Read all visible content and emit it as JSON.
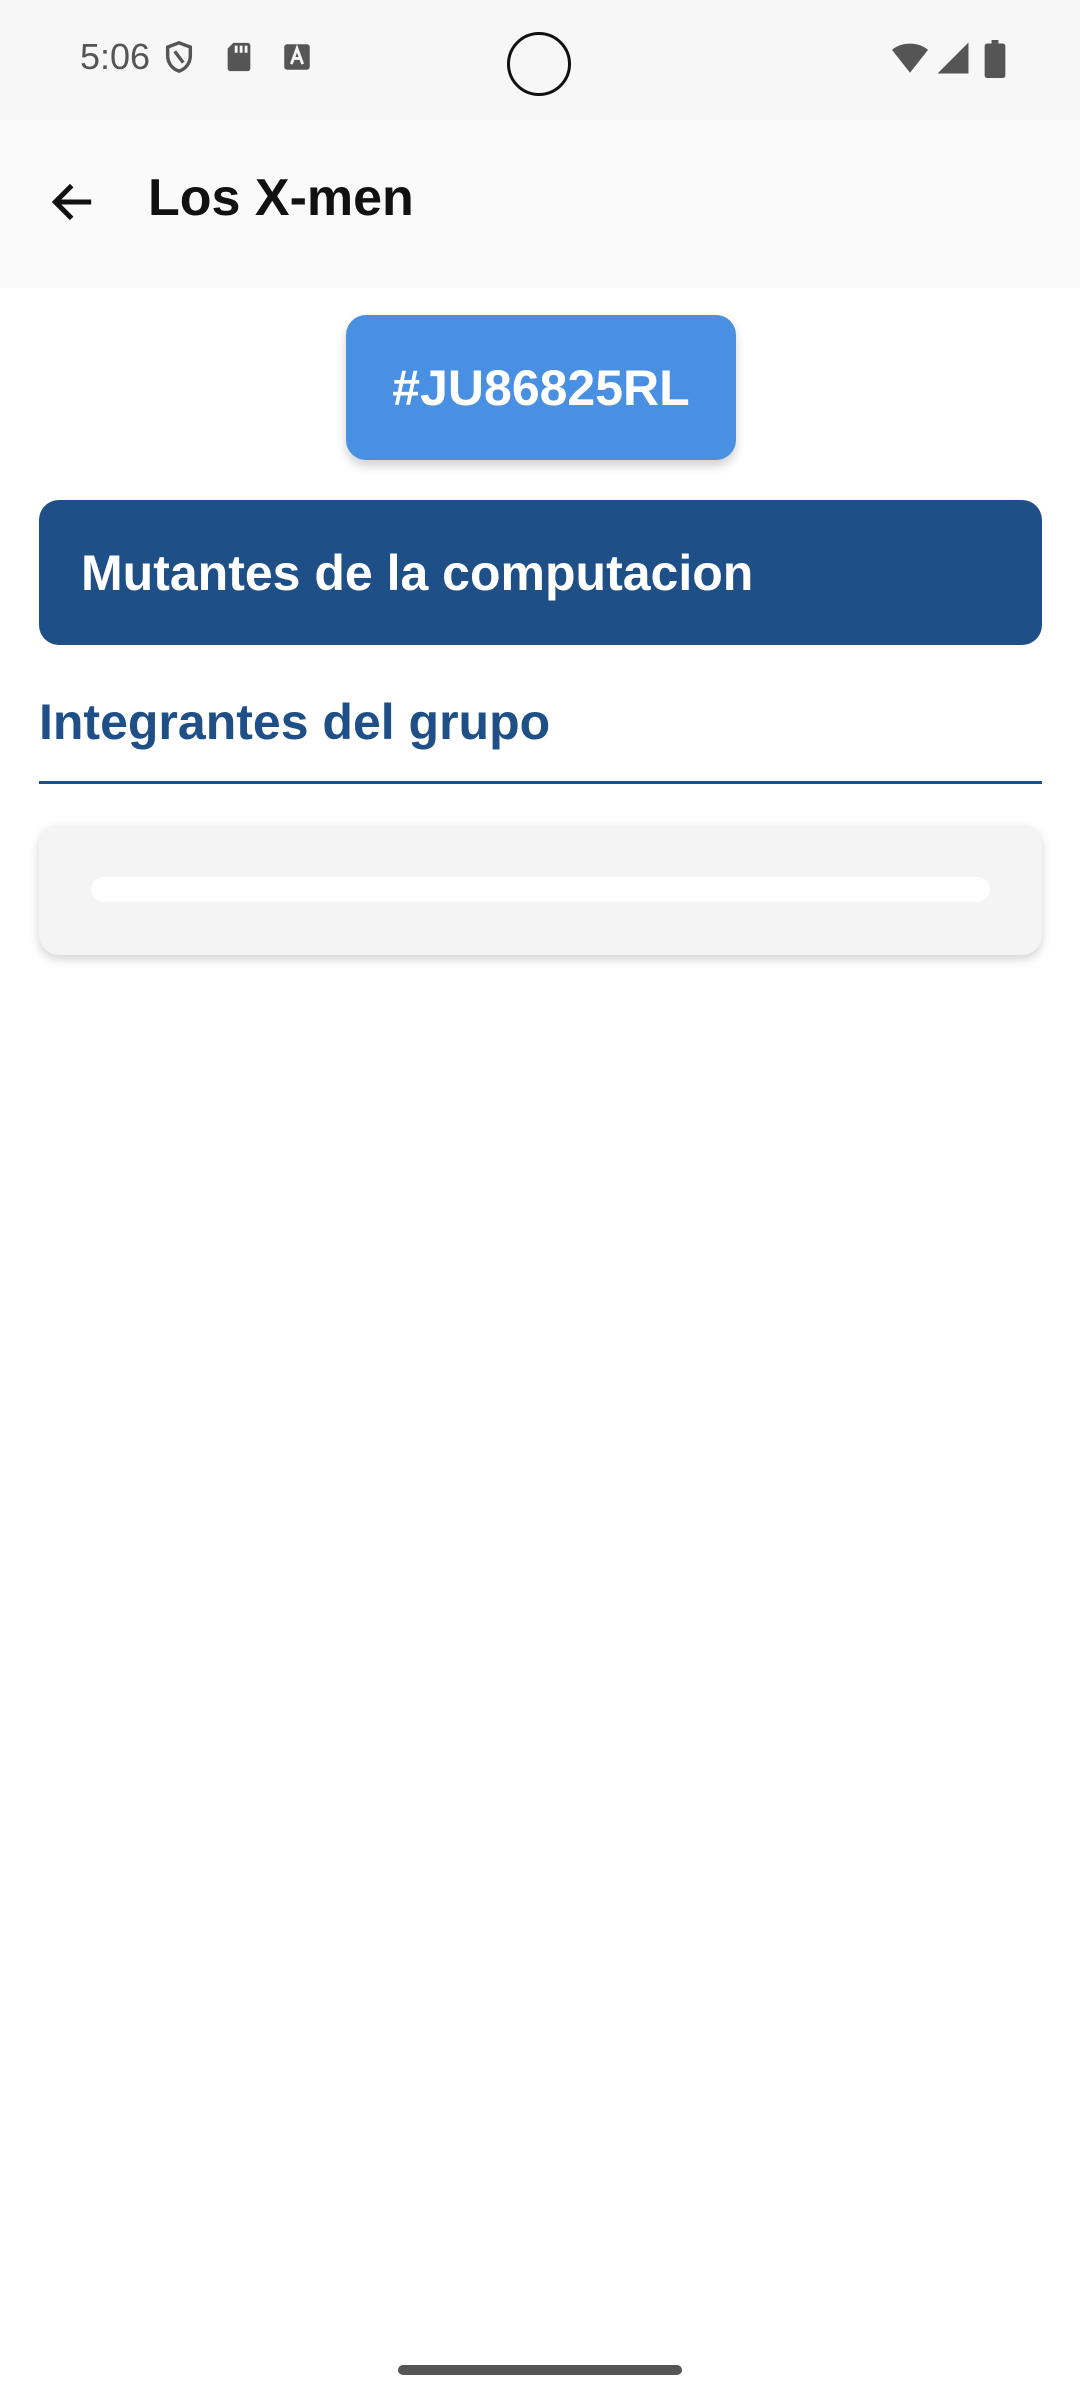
{
  "status_bar": {
    "time": "5:06",
    "left_icons": [
      "shield-icon",
      "sd-card-icon",
      "text-icon"
    ],
    "right_icons": [
      "wifi-icon",
      "signal-icon",
      "battery-icon"
    ]
  },
  "app_bar": {
    "back_icon": "arrow-back-icon",
    "title": "Los X-men"
  },
  "group": {
    "code": "#JU86825RL",
    "name": "Mutantes de la computacion"
  },
  "members_section": {
    "header": "Integrantes del grupo"
  },
  "colors": {
    "code_chip": "#4a90e2",
    "primary_dark": "#1e4f87",
    "card_background": "#f4f4f4"
  }
}
